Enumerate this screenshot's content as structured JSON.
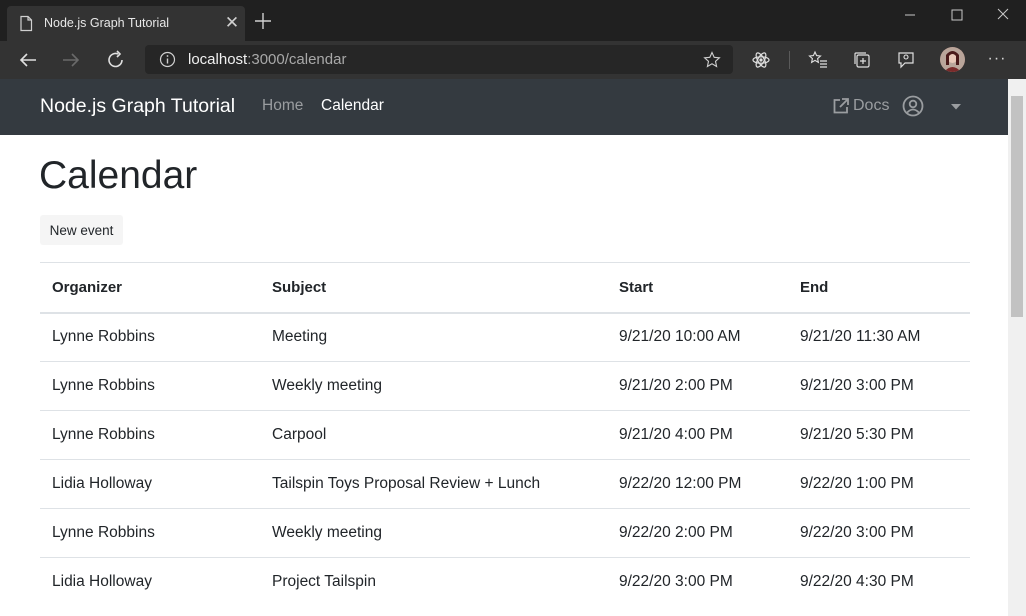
{
  "browser": {
    "tab_title": "Node.js Graph Tutorial",
    "url_host": "localhost",
    "url_rest": ":3000/calendar",
    "icons": [
      "page-icon",
      "close-icon",
      "plus-icon",
      "minimize-icon",
      "maximize-icon",
      "close-window-icon",
      "back-arrow-icon",
      "forward-arrow-icon",
      "refresh-icon",
      "info-icon",
      "star-icon",
      "react-extension-icon",
      "favorites-icon",
      "collections-icon",
      "feedback-icon",
      "avatar",
      "more-icon"
    ]
  },
  "navbar": {
    "brand": "Node.js Graph Tutorial",
    "home": "Home",
    "calendar": "Calendar",
    "docs": "Docs",
    "bg_color": "#343a40"
  },
  "page": {
    "title": "Calendar",
    "new_event": "New event"
  },
  "table": {
    "headers": [
      "Organizer",
      "Subject",
      "Start",
      "End"
    ],
    "rows": [
      [
        "Lynne Robbins",
        "Meeting",
        "9/21/20 10:00 AM",
        "9/21/20 11:30 AM"
      ],
      [
        "Lynne Robbins",
        "Weekly meeting",
        "9/21/20 2:00 PM",
        "9/21/20 3:00 PM"
      ],
      [
        "Lynne Robbins",
        "Carpool",
        "9/21/20 4:00 PM",
        "9/21/20 5:30 PM"
      ],
      [
        "Lidia Holloway",
        "Tailspin Toys Proposal Review + Lunch",
        "9/22/20 12:00 PM",
        "9/22/20 1:00 PM"
      ],
      [
        "Lynne Robbins",
        "Weekly meeting",
        "9/22/20 2:00 PM",
        "9/22/20 3:00 PM"
      ],
      [
        "Lidia Holloway",
        "Project Tailspin",
        "9/22/20 3:00 PM",
        "9/22/20 4:30 PM"
      ]
    ]
  }
}
